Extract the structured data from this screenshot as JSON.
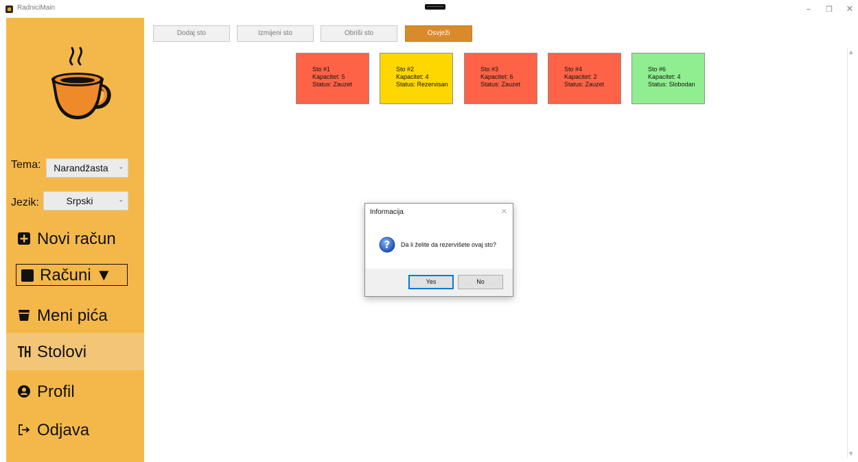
{
  "window": {
    "title": "RadniciMain"
  },
  "toolbar": {
    "add_label": "Dodaj sto",
    "edit_label": "Izmijeni sto",
    "delete_label": "Obriši sto",
    "refresh_label": "Osvježi"
  },
  "sidebar": {
    "theme_label": "Tema:",
    "theme_value": "Narandžasta",
    "language_label": "Jezik:",
    "language_value": "Srpski",
    "nav": [
      {
        "label": "Novi račun",
        "icon": "plus-square-icon"
      },
      {
        "label": "Računi ▼",
        "icon": "square-icon"
      },
      {
        "label": "Meni pića",
        "icon": "drink-icon"
      },
      {
        "label": "Stolovi",
        "icon": "table-icon",
        "active": true
      },
      {
        "label": "Profil",
        "icon": "user-circle-icon"
      },
      {
        "label": "Odjava",
        "icon": "logout-icon"
      }
    ]
  },
  "tables": [
    {
      "name": "Sto #1",
      "capacity": "Kapacitet: 5",
      "status": "Status: Zauzet",
      "color": "#ff6347"
    },
    {
      "name": "Sto #2",
      "capacity": "Kapacitet: 4",
      "status": "Status: Rezervisan",
      "color": "#ffd700"
    },
    {
      "name": "Sto #3",
      "capacity": "Kapacitet: 6",
      "status": "Status: Zauzet",
      "color": "#ff6347"
    },
    {
      "name": "Sto #4",
      "capacity": "Kapacitet: 2",
      "status": "Status: Zauzet",
      "color": "#ff6347"
    },
    {
      "name": "Sto #6",
      "capacity": "Kapacitet: 4",
      "status": "Status: Slobodan",
      "color": "#90ee90"
    }
  ],
  "dialog": {
    "title": "Informacija",
    "message": "Da li želite da rezervišete ovaj sto?",
    "yes_label": "Yes",
    "no_label": "No"
  },
  "colors": {
    "sidebar": "#f4b84a",
    "active_nav": "#f2c577",
    "accent": "#d98a2b"
  }
}
